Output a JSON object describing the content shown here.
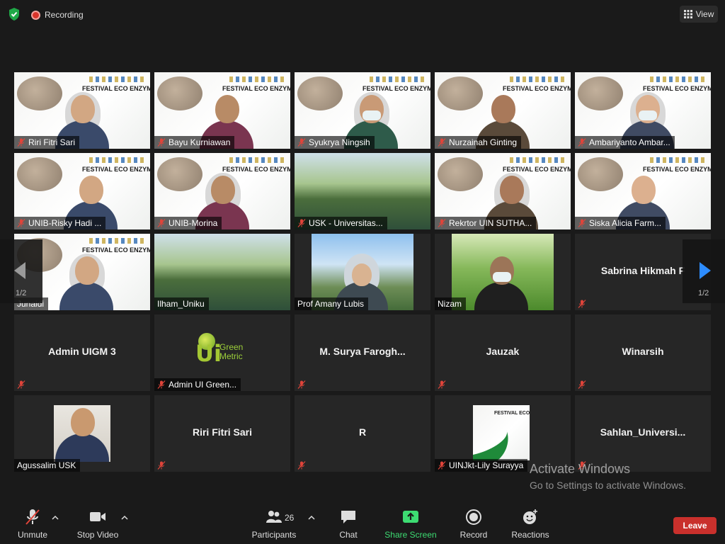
{
  "top": {
    "recording_label": "Recording",
    "view_label": "View"
  },
  "slide_title": "FESTIVAL ECO ENZYME",
  "pagination": {
    "prev": "1/2",
    "next": "1/2"
  },
  "participants": [
    {
      "name": "Riri Fitri Sari",
      "kind": "slide"
    },
    {
      "name": "Bayu Kurniawan",
      "kind": "slide"
    },
    {
      "name": "Syukrya Ningsih",
      "kind": "slide"
    },
    {
      "name": "Nurzainah Ginting",
      "kind": "slide"
    },
    {
      "name": "Ambariyanto Ambar...",
      "kind": "slide"
    },
    {
      "name": "UNIB-Risky Hadi ...",
      "kind": "slide"
    },
    {
      "name": "UNIB-Morina",
      "kind": "slide"
    },
    {
      "name": "USK - Universitas...",
      "kind": "pond"
    },
    {
      "name": "Rekrtor UIN SUTHA...",
      "kind": "slide"
    },
    {
      "name": "Siska Alicia Farm...",
      "kind": "slide"
    },
    {
      "name": "Junaidi",
      "kind": "slide"
    },
    {
      "name": "Ilham_Uniku",
      "kind": "pond"
    },
    {
      "name": "Prof Amany Lubis",
      "kind": "sky"
    },
    {
      "name": "Nizam",
      "kind": "grass"
    },
    {
      "name": "Sabrina Hikmah F",
      "kind": "name"
    },
    {
      "name": "Admin UIGM 3",
      "kind": "name"
    },
    {
      "name": "Admin UI Green...",
      "kind": "logo"
    },
    {
      "name": "M. Surya Farogh...",
      "kind": "name"
    },
    {
      "name": "Jauzak",
      "kind": "name"
    },
    {
      "name": "Winarsih",
      "kind": "name"
    },
    {
      "name": "Agussalim USK",
      "kind": "photo"
    },
    {
      "name": "Riri Fitri Sari",
      "kind": "name"
    },
    {
      "name": "R",
      "kind": "name"
    },
    {
      "name": "UINJkt-Lily Surayya",
      "kind": "slide-small"
    },
    {
      "name": "Sahlan_Universi...",
      "kind": "name"
    }
  ],
  "logo": {
    "ui": "Ui",
    "green": "Green",
    "metric": "Metric"
  },
  "watermark": {
    "line1": "Activate Windows",
    "line2": "Go to Settings to activate Windows."
  },
  "toolbar": {
    "unmute": "Unmute",
    "stop_video": "Stop Video",
    "participants": "Participants",
    "participants_count": "26",
    "chat": "Chat",
    "share_screen": "Share Screen",
    "record": "Record",
    "reactions": "Reactions",
    "leave": "Leave"
  },
  "colors": {
    "accent_green": "#3ddc72",
    "leave_red": "#c9302c",
    "active_speaker": "#d6e05f",
    "nav_blue": "#2d8cff"
  }
}
